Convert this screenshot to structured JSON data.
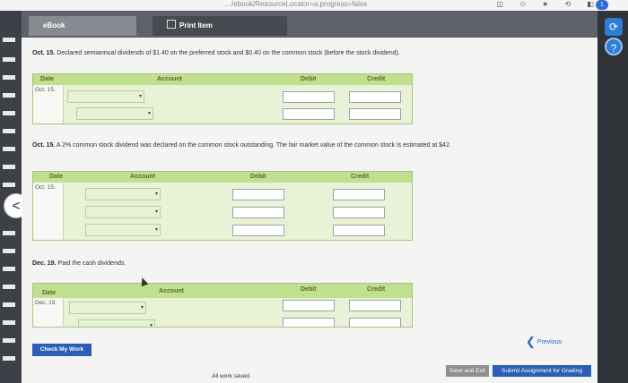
{
  "browser": {
    "url_fragment": "…/ebook/ResourceLocator=a.progress=false",
    "icons": "◫ ✩ ★ ⟲ ◧",
    "badge": "1"
  },
  "tabs": {
    "ebook": "eBook",
    "print": "Print Item"
  },
  "q1": {
    "prompt_date": "Oct. 15.",
    "prompt_text": "Declared semiannual dividends of $1.40 on the preferred stock and $0.40 on the common stock (before the stock dividend).",
    "headers": {
      "date": "Date",
      "account": "Account",
      "debit": "Debit",
      "credit": "Credit"
    },
    "row_date": "Oct. 15."
  },
  "q2": {
    "prompt_date": "Oct. 15.",
    "prompt_text": "A 2% common stock dividend was declared on the common stock outstanding. The fair market value of the common stock is estimated at $42.",
    "headers": {
      "date": "Date",
      "account": "Account",
      "debit": "Debit",
      "credit": "Credit"
    },
    "row_date": "Oct. 15."
  },
  "q3": {
    "prompt_date": "Dec. 19.",
    "prompt_text": "Paid the cash dividends.",
    "headers": {
      "date": "Date",
      "account": "Account",
      "debit": "Debit",
      "credit": "Credit"
    },
    "row_date": "Dec. 19."
  },
  "buttons": {
    "check": "Check My Work",
    "previous": "Previous",
    "save_exit": "Save and Exit",
    "submit": "Submit Assignment for Grading"
  },
  "status": {
    "saved": "All work saved."
  },
  "rails": {
    "prev_nav": "<",
    "help_icon": "?",
    "refresh_icon": "⟳"
  }
}
